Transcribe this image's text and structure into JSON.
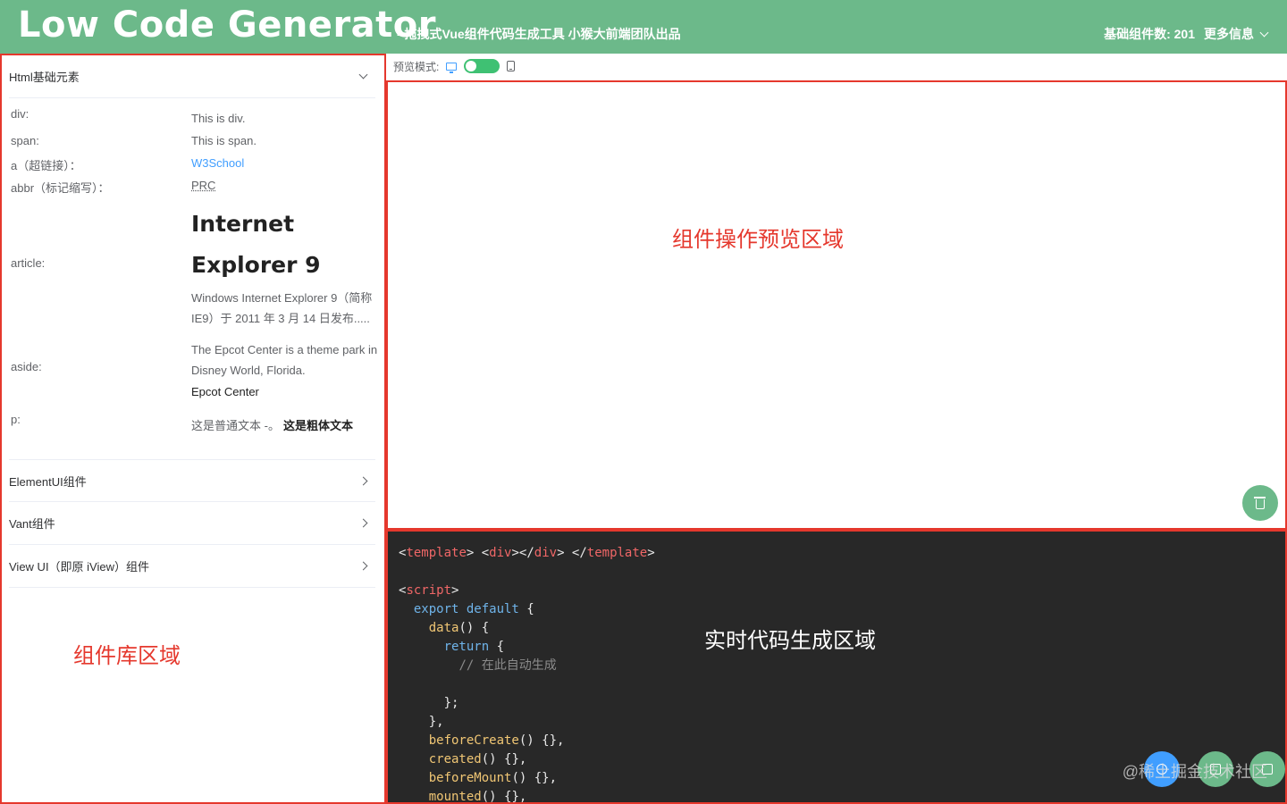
{
  "header": {
    "logo": "Low Code Generator",
    "subtitle": "- 拖拽式Vue组件代码生成工具 小猴大前端团队出品",
    "component_count": "基础组件数: 201",
    "more_info": "更多信息"
  },
  "sidebar": {
    "sections": [
      {
        "label": "Html基础元素",
        "expanded": true
      },
      {
        "label": "ElementUI组件",
        "expanded": false
      },
      {
        "label": "Vant组件",
        "expanded": false
      },
      {
        "label": "View UI（即原 iView）组件",
        "expanded": false
      }
    ],
    "html_items": {
      "div_label": "div:",
      "div_value": "This is div.",
      "span_label": "span:",
      "span_value": "This is span.",
      "a_label": "a（超链接）：",
      "a_value": "W3School",
      "abbr_label": "abbr（标记缩写）：",
      "abbr_value": "PRC",
      "article_label": "article:",
      "article_title_1": "Internet",
      "article_title_2": "Explorer 9",
      "article_text": "Windows Internet Explorer 9（简称 IE9）于 2011 年 3 月 14 日发布.....",
      "aside_label": "aside:",
      "aside_text": "The Epcot Center is a theme park in Disney World, Florida.",
      "aside_title": "Epcot Center",
      "p_label": "p:",
      "p_normal": "这是普通文本 -。",
      "p_bold": "这是粗体文本"
    },
    "area_label": "组件库区域"
  },
  "preview": {
    "mode_label": "预览模式:",
    "area_label": "组件操作预览区域"
  },
  "code": {
    "area_label": "实时代码生成区域",
    "comment": "// 在此自动生成",
    "watermark": "@稀土掘金技术社区"
  },
  "colors": {
    "header_green": "#6cb98a",
    "annotation_red": "#e5382d",
    "code_bg": "#282828",
    "toggle_green": "#3fc173"
  }
}
